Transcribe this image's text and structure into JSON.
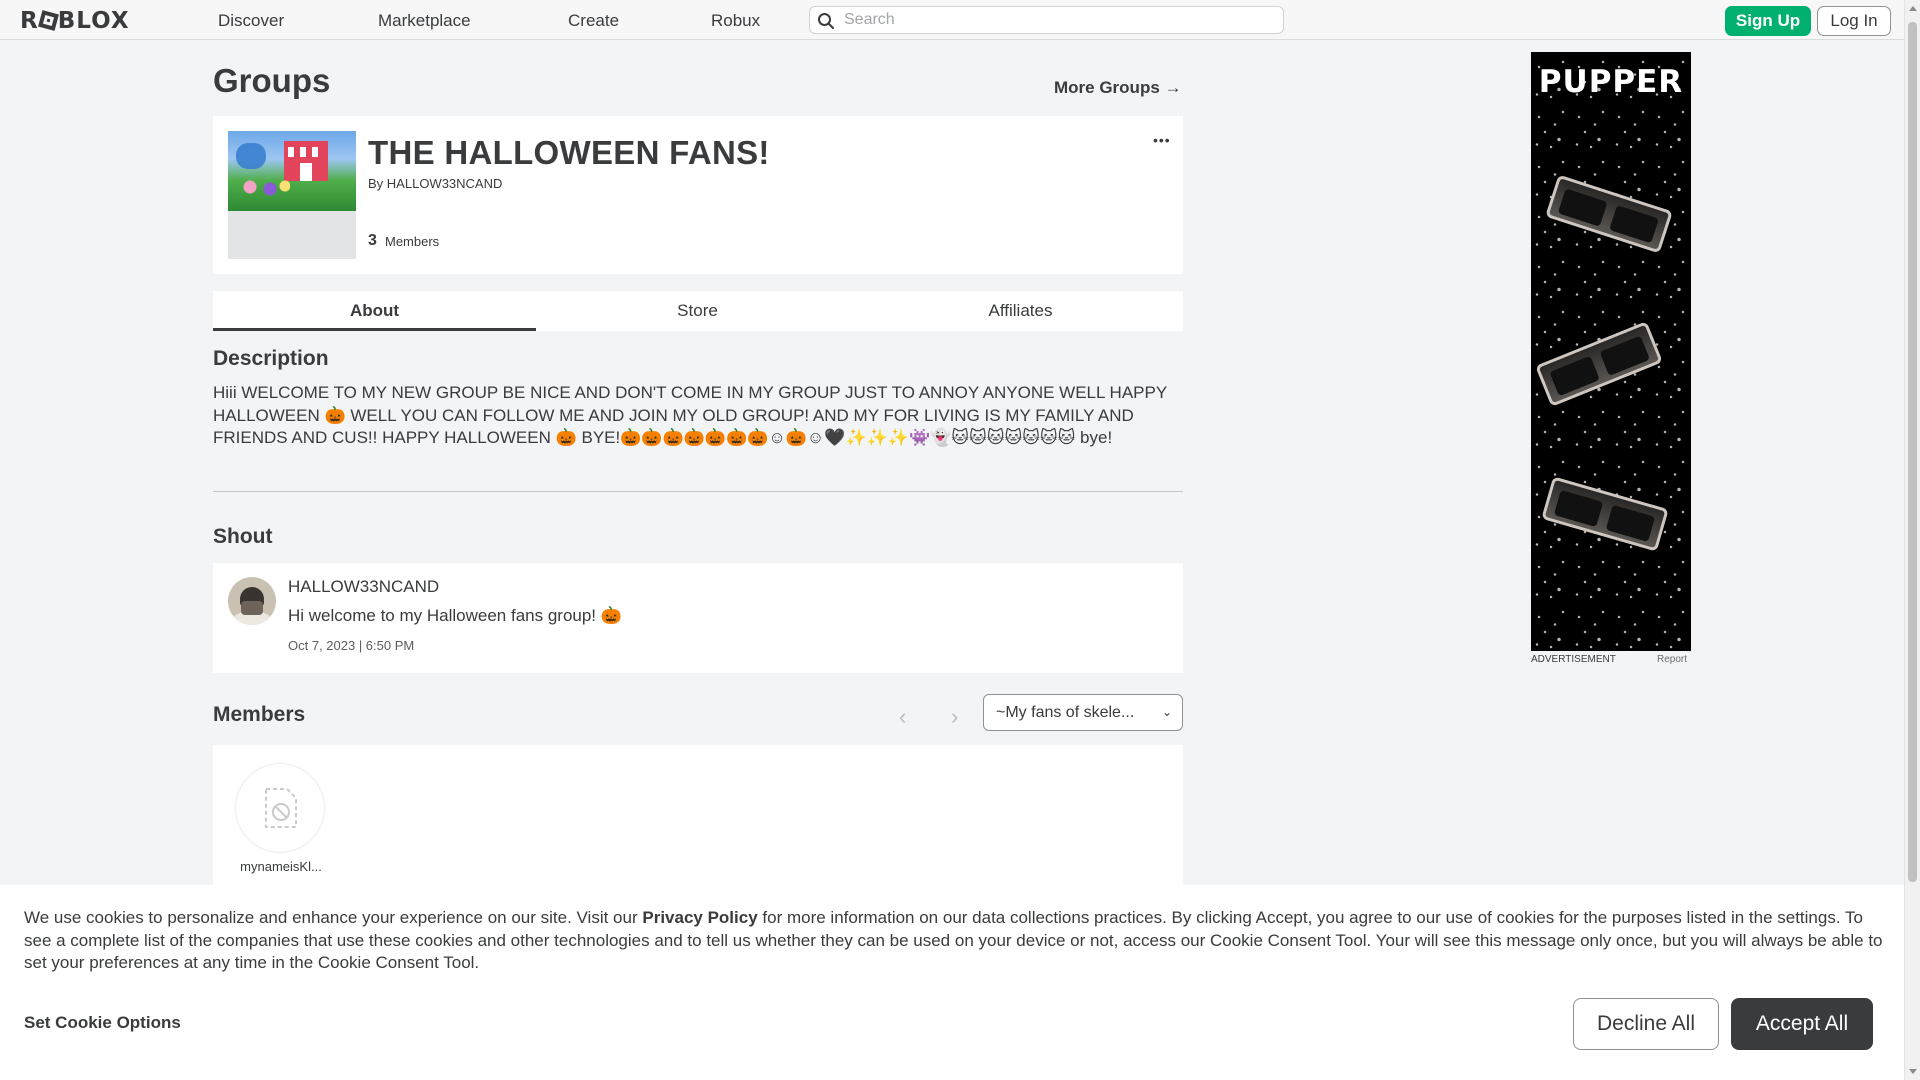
{
  "nav": {
    "logo": "ROBLOX",
    "links": [
      "Discover",
      "Marketplace",
      "Create",
      "Robux"
    ],
    "search_placeholder": "Search",
    "signup": "Sign Up",
    "login": "Log In"
  },
  "page": {
    "title": "Groups",
    "more_groups": "More Groups →"
  },
  "group": {
    "name": "THE HALLOWEEN FANS!",
    "by_prefix": "By",
    "owner": "HALLOW33NCAND",
    "member_count": "3",
    "members_label": "Members",
    "more_menu": "•••"
  },
  "tabs": [
    "About",
    "Store",
    "Affiliates"
  ],
  "description": {
    "title": "Description",
    "text": "Hiii WELCOME TO MY NEW GROUP BE NICE AND DON'T COME IN MY GROUP JUST TO ANNOY ANYONE WELL HAPPY HALLOWEEN 🎃 WELL YOU CAN FOLLOW ME AND JOIN MY OLD GROUP! AND MY FOR LIVING IS MY FAMILY AND FRIENDS AND CUS!! HAPPY HALLOWEEN 🎃 BYE!🎃🎃🎃🎃🎃🎃🎃☺🎃☺🖤✨✨✨👾👻🐱🐱🐱🐱🐱🐱🐱 bye!"
  },
  "shout": {
    "title": "Shout",
    "author": "HALLOW33NCAND",
    "body": "Hi welcome to my Halloween fans group! 🎃",
    "timestamp": "Oct 7, 2023 | 6:50 PM"
  },
  "members": {
    "title": "Members",
    "prev": "‹",
    "next": "›",
    "role_selected": "~My fans of skele...",
    "list": [
      {
        "name": "mynameisKl..."
      }
    ]
  },
  "ad": {
    "brand": "PUPPER",
    "caption": "ADVERTISEMENT",
    "report": "Report"
  },
  "cookie": {
    "text_before": "We use cookies to personalize and enhance your experience on our site. Visit our ",
    "privacy_link": "Privacy Policy",
    "text_after": " for more information on our data collections practices. By clicking Accept, you agree to our use of cookies for the purposes listed in the settings. To see a complete list of the companies that use these cookies and other technologies and to tell us whether they can be used on your device or not, access our Cookie Consent Tool. Your will see this message only once, but you will always be able to set your preferences at any time in the Cookie Consent Tool.",
    "set_options": "Set Cookie Options",
    "decline": "Decline All",
    "accept": "Accept All"
  },
  "colors": {
    "accent_green": "#00b06f",
    "text": "#393b3d",
    "background": "#f2f4f5",
    "accept_button": "#393b3d"
  }
}
